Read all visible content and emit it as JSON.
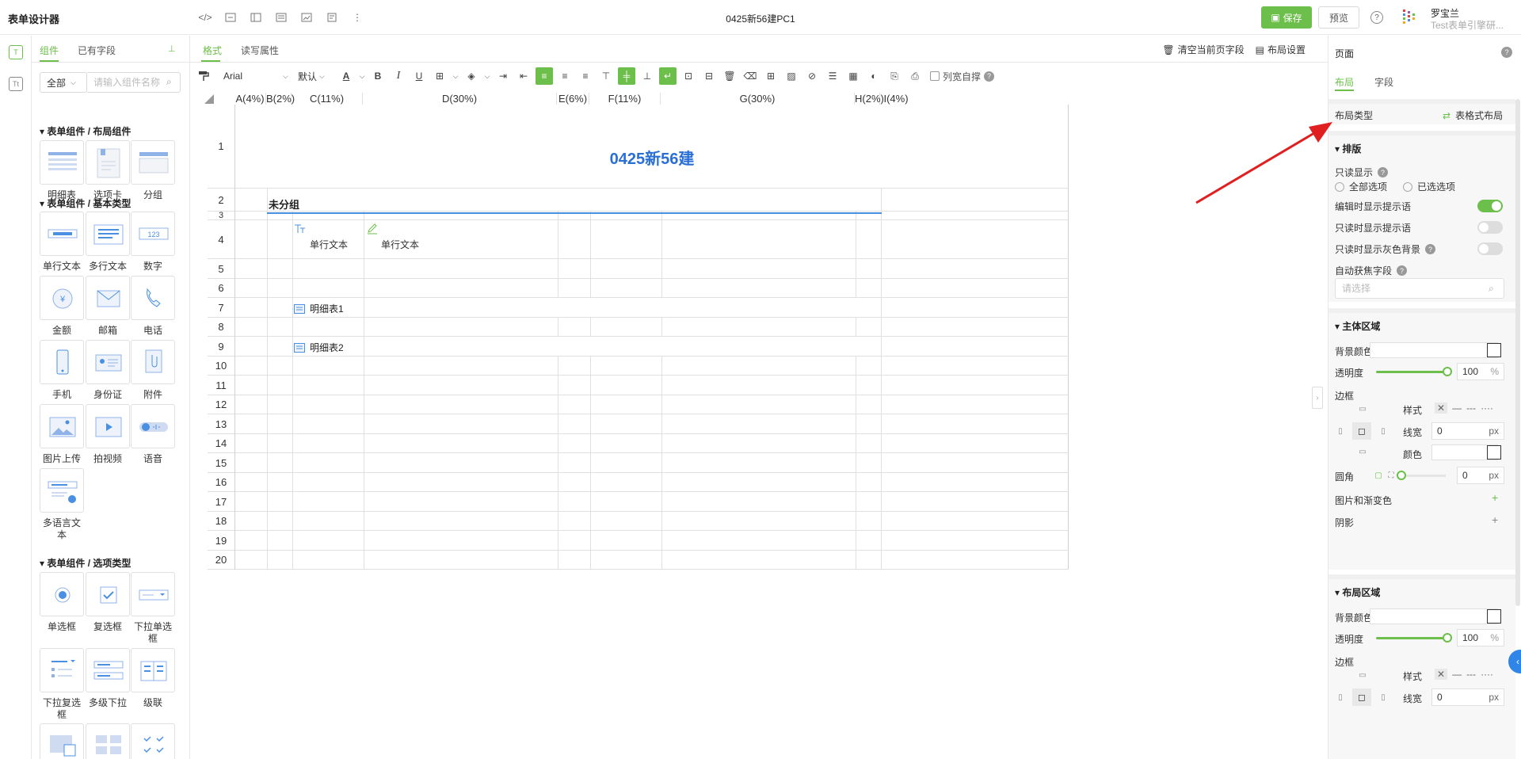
{
  "app": {
    "title": "表单设计器",
    "doc_title": "0425新56建PC1",
    "save_label": "保存",
    "preview_label": "预览",
    "help_glyph": "?",
    "user_name": "罗宝兰",
    "user_org": "Test表单引擎研..."
  },
  "library": {
    "tabs": [
      "组件",
      "已有字段"
    ],
    "filter_value": "全部",
    "search_placeholder": "请输入组件名称",
    "sections": [
      {
        "title": "表单组件 / 布局组件",
        "items": [
          "明细表",
          "选项卡",
          "分组"
        ]
      },
      {
        "title": "表单组件 / 基本类型",
        "items": [
          "单行文本",
          "多行文本",
          "数字",
          "金额",
          "邮箱",
          "电话",
          "手机",
          "身份证",
          "附件",
          "图片上传",
          "拍视频",
          "语音",
          "多语言文本"
        ]
      },
      {
        "title": "表单组件 / 选项类型",
        "items": [
          "单选框",
          "复选框",
          "下拉单选框",
          "下拉复选框",
          "多级下拉",
          "级联"
        ]
      }
    ],
    "number_icon_text": "123"
  },
  "editor": {
    "tabs": [
      "格式",
      "读写属性"
    ],
    "actions": [
      "清空当前页字段",
      "布局设置"
    ],
    "font": "Arial",
    "size": "默认",
    "autofit_label": "列宽自撑",
    "columns": [
      "A(4%)",
      "B(2%)",
      "C(11%)",
      "D(30%)",
      "E(6%)",
      "F(11%)",
      "G(30%)",
      "H(2%)",
      "I(4%)"
    ],
    "rows": [
      "1",
      "2",
      "3",
      "4",
      "5",
      "6",
      "7",
      "8",
      "9",
      "10",
      "11",
      "12",
      "13",
      "14",
      "15",
      "16",
      "17",
      "18",
      "19",
      "20"
    ],
    "form_title": "0425新56建",
    "group_label": "未分组",
    "field_label": "单行文本",
    "field_input": "单行文本",
    "detail_tables": [
      "明细表1",
      "明细表2"
    ]
  },
  "props": {
    "header": "页面",
    "tabs": [
      "布局",
      "字段"
    ],
    "layout_type_label": "布局类型",
    "layout_type_value": "表格式布局",
    "typeset_title": "排版",
    "readonly_label": "只读显示",
    "readonly_options": [
      "全部选项",
      "已选选项"
    ],
    "toggles": [
      {
        "label": "编辑时显示提示语",
        "on": true
      },
      {
        "label": "只读时显示提示语",
        "on": false
      },
      {
        "label": "只读时显示灰色背景",
        "on": false
      }
    ],
    "autofocus_label": "自动获焦字段",
    "autofocus_placeholder": "请选择",
    "main_area": {
      "title": "主体区域",
      "bg_label": "背景颜色",
      "opacity_label": "透明度",
      "opacity_value": "100",
      "percent": "%",
      "border_label": "边框",
      "style_label": "样式",
      "width_label": "线宽",
      "width_value": "0",
      "unit": "px",
      "color_label": "颜色",
      "radius_label": "圆角",
      "radius_value": "0",
      "image_label": "图片和渐变色",
      "shadow_label": "阴影"
    },
    "layout_area": {
      "title": "布局区域",
      "bg_label": "背景颜色",
      "opacity_label": "透明度",
      "opacity_value": "100",
      "border_label": "边框",
      "style_label": "样式",
      "width_label": "线宽",
      "width_value": "0"
    }
  },
  "colors": {
    "accent": "#6cbf4a",
    "title_blue": "#2a6fd6",
    "annotation_red": "#e02020"
  }
}
